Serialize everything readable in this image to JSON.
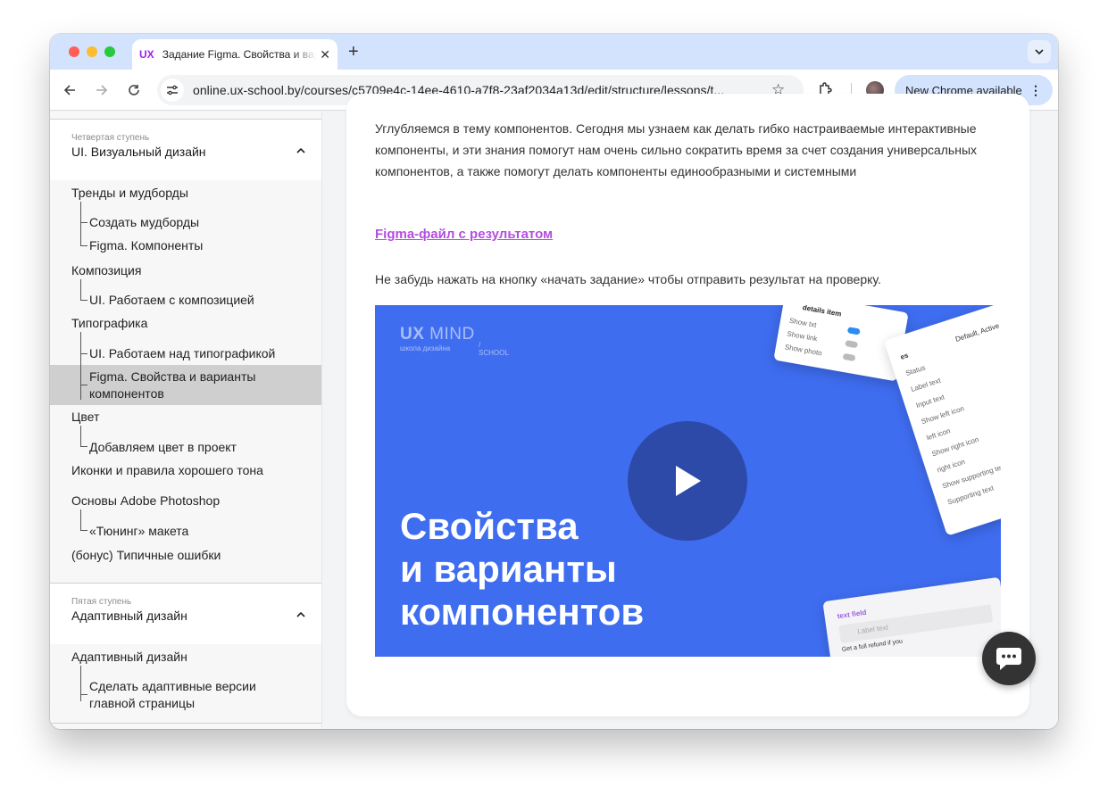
{
  "browser": {
    "tab": {
      "favicon_text": "UX",
      "title": "Задание Figma. Свойства и варианты компонентов"
    },
    "url": "online.ux-school.by/courses/c5709e4c-14ee-4610-a7f8-23af2034a13d/edit/structure/lessons/t...",
    "update_button": "New Chrome available"
  },
  "sidebar": {
    "sections": [
      {
        "sub": "Четвертая ступень",
        "title": "UI. Визуальный дизайн",
        "lessons": [
          {
            "label": "Тренды и мудборды",
            "children": [
              "Создать мудборды",
              "Figma. Компоненты"
            ]
          },
          {
            "label": "Композиция",
            "children": [
              "UI. Работаем с композицией"
            ]
          },
          {
            "label": "Типографика",
            "children": [
              "UI. Работаем над типографикой",
              "Figma. Свойства и варианты компонентов"
            ]
          },
          {
            "label": "Цвет",
            "children": [
              "Добавляем цвет в проект"
            ]
          },
          {
            "label": "Иконки и правила хорошего тона",
            "children": []
          },
          {
            "label": "Основы Adobe Photoshop",
            "children": [
              "«Тюнинг» макета"
            ]
          },
          {
            "label": "(бонус) Типичные ошибки",
            "children": []
          }
        ]
      },
      {
        "sub": "Пятая ступень",
        "title": "Адаптивный дизайн",
        "lessons": [
          {
            "label": "Адаптивный дизайн",
            "children": [
              "Сделать адаптивные версии главной страницы"
            ]
          }
        ]
      }
    ],
    "active_lesson": "Figma. Свойства и варианты компонентов"
  },
  "main": {
    "intro": "Углубляемся в тему компонентов. Сегодня мы узнаем как делать гибко настраиваемые интерактивные компоненты, и эти знания помогут нам очень сильно сократить время за счет создания универсальных компонентов, а также помогут делать компоненты единообразными и системными",
    "figma_link": "Figma-файл с результатом",
    "reminder": "Не забудь нажать на кнопку «начать задание» чтобы отправить результат на проверку.",
    "video": {
      "brand_bold": "UX",
      "brand_rest": " MIND",
      "brand_sub": "школа дизайна",
      "brand_school": "/ SCHOOL",
      "title_lines": [
        "Свойства",
        "и варианты",
        "компонентов"
      ],
      "panel1": {
        "title": "details item",
        "rows": [
          "Show txt",
          "Show link",
          "Show photo"
        ],
        "toggles_on": [
          true,
          false,
          false
        ]
      },
      "panel2": {
        "header": "es",
        "header_value": "Default, Active",
        "rows": [
          "Status",
          "Label text",
          "Input text",
          "Show left icon",
          "left icon",
          "Show right icon",
          "right icon",
          "Show supporting text",
          "Supporting text"
        ]
      },
      "panel3": {
        "title": "text field",
        "label": "Label text",
        "helper": "Get a full refund if you"
      }
    }
  },
  "colors": {
    "accent_link": "#b44de0",
    "video_bg": "#3f6df0",
    "play_bg": "#2d4aa8"
  }
}
